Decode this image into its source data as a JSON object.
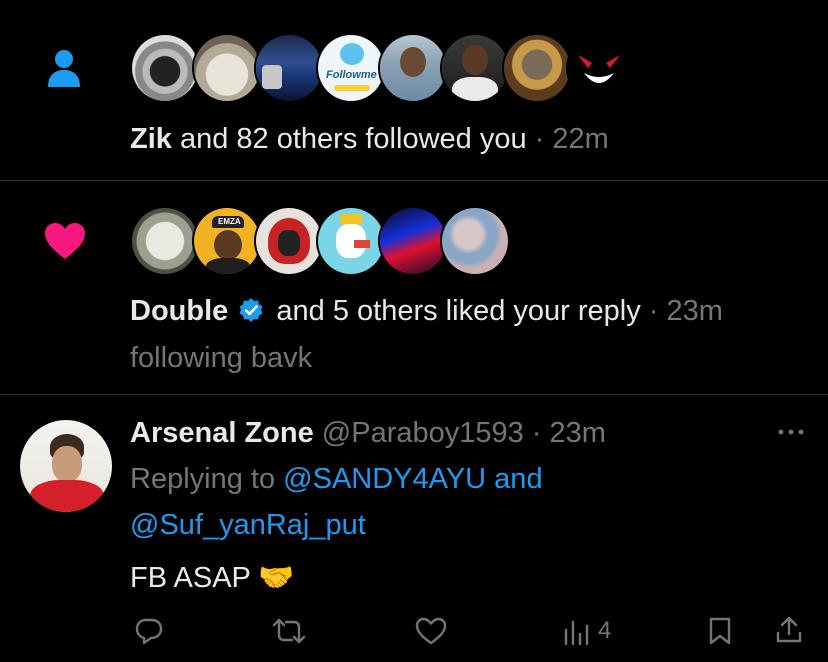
{
  "follow_notification": {
    "icon": "person-icon",
    "bold_name": "Zik",
    "text": " and 82 others followed you",
    "separator": " · ",
    "time": "22m",
    "avatars": [
      "avatar-messy-hair",
      "avatar-cat",
      "avatar-footballer-trophy",
      "avatar-follow-me-bird",
      "avatar-man-portrait",
      "avatar-man-dark",
      "avatar-hippo",
      "avatar-gengar"
    ],
    "avatar_text": {
      "follow_me_badge": "Followme"
    }
  },
  "like_notification": {
    "icon": "heart-icon",
    "bold_name": "Double",
    "verified": true,
    "text": " and 5 others liked your reply",
    "separator": " · ",
    "time": "23m",
    "subtext": "following bavk",
    "avatars": [
      "avatar-anime",
      "avatar-emza",
      "avatar-spartan",
      "avatar-crowned-duck",
      "avatar-neon",
      "avatar-blurred"
    ],
    "avatar_text": {
      "emza_cap": "EMZA"
    }
  },
  "reply": {
    "display_name": "Arsenal Zone",
    "handle": "@Paraboy1593",
    "separator": " · ",
    "time": "23m",
    "replying_prefix": "Replying to ",
    "reply_to_1": "@SANDY4AYU",
    "reply_join": " and",
    "reply_to_2": "@Suf_yanRaj_put",
    "body_text": "FB ASAP ",
    "body_emoji": "🤝",
    "more_icon": "more-dots-icon",
    "views_count": "4"
  },
  "colors": {
    "background": "#000000",
    "text": "#e7e9ea",
    "muted": "#71767b",
    "link": "#1d9bf0",
    "follow_icon": "#1d9bf0",
    "heart": "#f91880",
    "divider": "#2f3336"
  }
}
